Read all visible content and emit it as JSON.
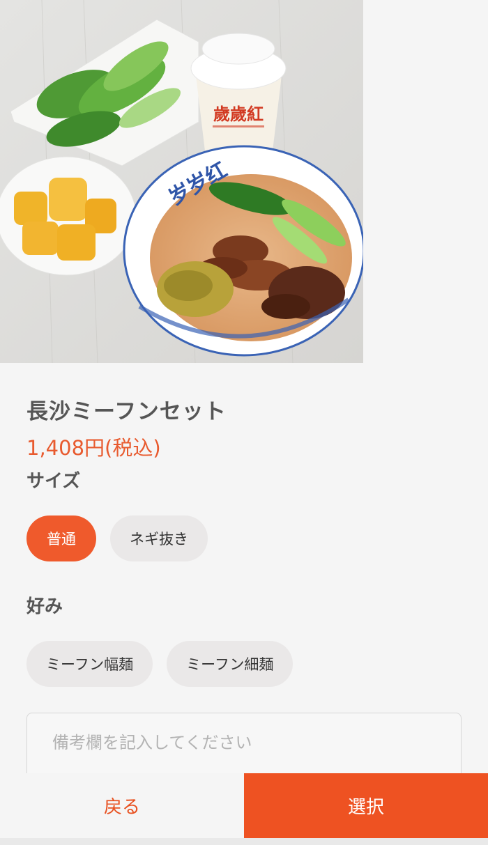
{
  "product": {
    "image_alt": "長沙ミーフンセット",
    "bowl_text": "岁岁红",
    "cup_text": "歲歲紅",
    "name": "長沙ミーフンセット",
    "price": "1,408円(税込)"
  },
  "options": {
    "size": {
      "label": "サイズ",
      "items": [
        {
          "label": "普通",
          "selected": true
        },
        {
          "label": "ネギ抜き",
          "selected": false
        }
      ]
    },
    "preference": {
      "label": "好み",
      "items": [
        {
          "label": "ミーフン幅麺",
          "selected": false
        },
        {
          "label": "ミーフン細麺",
          "selected": false
        }
      ]
    }
  },
  "notes": {
    "placeholder": "備考欄を記入してください"
  },
  "actions": {
    "back_label": "戻る",
    "select_label": "選択"
  },
  "colors": {
    "accent": "#ee5222",
    "price": "#e85a2e",
    "chip_bg": "#eae8e8"
  }
}
